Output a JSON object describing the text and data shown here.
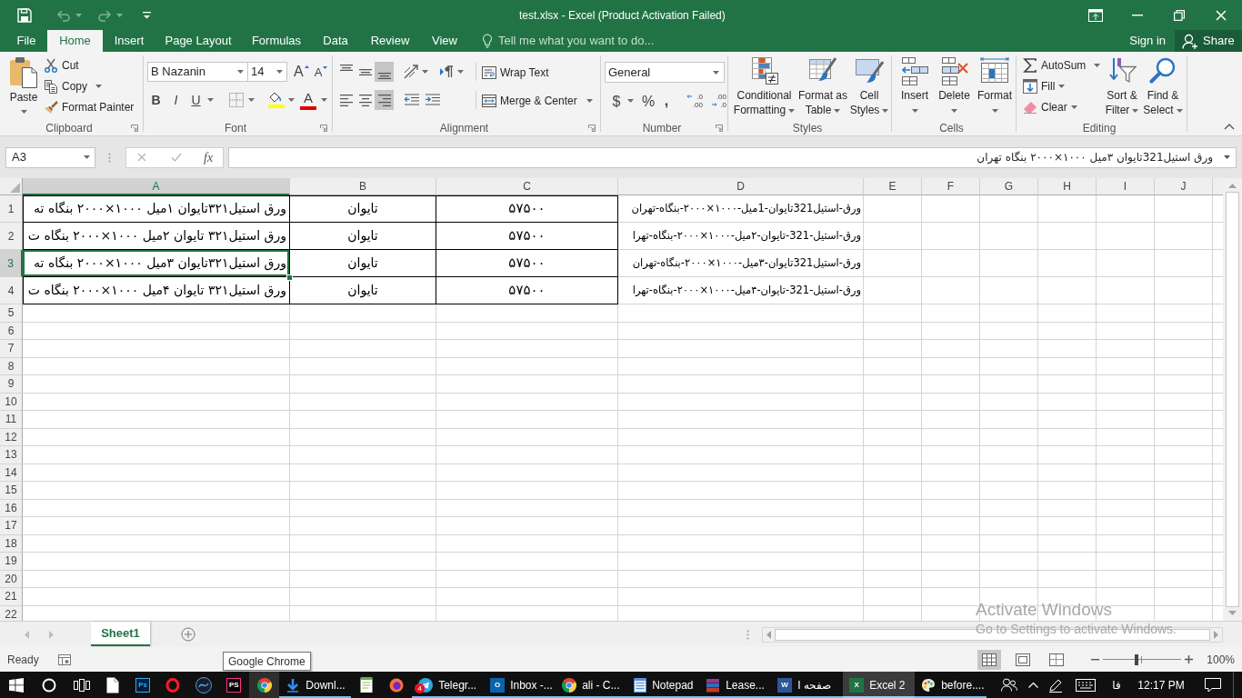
{
  "title_bar": {
    "title": "test.xlsx - Excel (Product Activation Failed)",
    "quick_access": [
      {
        "kind": "save",
        "disabled": false
      },
      {
        "kind": "undo",
        "disabled": true
      },
      {
        "kind": "redo",
        "disabled": true
      },
      {
        "kind": "customize",
        "disabled": false
      }
    ]
  },
  "ribbon_tabs": [
    {
      "label": "File",
      "selected": false
    },
    {
      "label": "Home",
      "selected": true
    },
    {
      "label": "Insert",
      "selected": false
    },
    {
      "label": "Page Layout",
      "selected": false
    },
    {
      "label": "Formulas",
      "selected": false
    },
    {
      "label": "Data",
      "selected": false
    },
    {
      "label": "Review",
      "selected": false
    },
    {
      "label": "View",
      "selected": false
    }
  ],
  "tell_me": {
    "placeholder": "Tell me what you want to do..."
  },
  "account": {
    "sign_in": "Sign in",
    "share": "Share"
  },
  "ribbon": {
    "clipboard": {
      "label": "Clipboard",
      "paste": "Paste",
      "cut": "Cut",
      "copy": "Copy",
      "format_painter": "Format Painter"
    },
    "font": {
      "label": "Font",
      "font_name": "B Nazanin",
      "font_size": "14",
      "grow_font": "A",
      "shrink_font": "A",
      "bold": "B",
      "italic": "I",
      "underline": "U",
      "font_color": "A"
    },
    "alignment": {
      "label": "Alignment",
      "vertical": [
        {
          "kind": "top",
          "selected": false
        },
        {
          "kind": "middle",
          "selected": false
        },
        {
          "kind": "bottom",
          "selected": true
        }
      ],
      "horizontal": [
        {
          "kind": "left",
          "selected": false
        },
        {
          "kind": "center",
          "selected": false
        },
        {
          "kind": "right",
          "selected": true
        }
      ],
      "wrap_text": "Wrap Text",
      "merge_center": "Merge & Center"
    },
    "number": {
      "label": "Number",
      "format": "General",
      "currency": "$",
      "percent": "%",
      "comma": ",",
      "increase_decimal": [
        ".0",
        ".00"
      ],
      "decrease_decimal": [
        ".00",
        ".0"
      ]
    },
    "styles": {
      "label": "Styles",
      "buttons": [
        {
          "kind": "conditional",
          "lines": [
            "Conditional",
            "Formatting"
          ]
        },
        {
          "kind": "table",
          "lines": [
            "Format as",
            "Table"
          ]
        },
        {
          "kind": "cell_styles",
          "lines": [
            "Cell",
            "Styles"
          ]
        }
      ]
    },
    "cells": {
      "label": "Cells",
      "buttons": [
        {
          "kind": "insert",
          "label": "Insert"
        },
        {
          "kind": "delete",
          "label": "Delete"
        },
        {
          "kind": "format",
          "label": "Format"
        }
      ]
    },
    "editing": {
      "label": "Editing",
      "autosum": "AutoSum",
      "fill": "Fill",
      "clear": "Clear",
      "buttons": [
        {
          "kind": "sort",
          "lines": [
            "Sort &",
            "Filter"
          ]
        },
        {
          "kind": "find",
          "lines": [
            "Find &",
            "Select"
          ]
        }
      ]
    }
  },
  "formula_bar": {
    "name_box": "A3",
    "insert_function": "fx",
    "formula": "ورق استیل321تایوان ۳میل ۱۰۰۰×۲۰۰۰ بنگاه تهران"
  },
  "sheet": {
    "columns": [
      {
        "label": "A",
        "selected": true
      },
      {
        "label": "B",
        "selected": false
      },
      {
        "label": "C",
        "selected": false
      },
      {
        "label": "D",
        "selected": false
      },
      {
        "label": "E",
        "selected": false
      },
      {
        "label": "F",
        "selected": false
      },
      {
        "label": "G",
        "selected": false
      },
      {
        "label": "H",
        "selected": false
      },
      {
        "label": "I",
        "selected": false
      },
      {
        "label": "J",
        "selected": false
      }
    ],
    "rows": [
      {
        "label": "1",
        "selected": false,
        "cells": {
          "column_a": {
            "text": "ورق استیل۳۲۱تایوان ۱میل ۱۰۰۰×۲۰۰۰ بنگاه ته",
            "selected": false,
            "bordered": true
          },
          "column_b": {
            "text": "تایوان",
            "selected": false,
            "bordered": true
          },
          "column_c": {
            "text": "۵۷۵۰۰",
            "selected": false,
            "bordered": true
          },
          "column_d": {
            "text": "ورق-استیل321تایوان-1میل-۱۰۰۰×۲۰۰۰-بنگاه-تهران",
            "selected": false,
            "bordered": false
          }
        }
      },
      {
        "label": "2",
        "selected": false,
        "cells": {
          "column_a": {
            "text": "ورق استیل۳۲۱ تایوان ۲میل ۱۰۰۰×۲۰۰۰ بنگاه ت",
            "selected": false,
            "bordered": true
          },
          "column_b": {
            "text": "تایوان",
            "selected": false,
            "bordered": true
          },
          "column_c": {
            "text": "۵۷۵۰۰",
            "selected": false,
            "bordered": true
          },
          "column_d": {
            "text": "ورق-استیل-321-تایوان-۲میل-۱۰۰۰×۲۰۰۰-بنگاه-تهرا",
            "selected": false,
            "bordered": false
          }
        }
      },
      {
        "label": "3",
        "selected": true,
        "cells": {
          "column_a": {
            "text": "ورق استیل۳۲۱تایوان ۳میل ۱۰۰۰×۲۰۰۰ بنگاه ته",
            "selected": true,
            "bordered": true
          },
          "column_b": {
            "text": "تایوان",
            "selected": false,
            "bordered": true
          },
          "column_c": {
            "text": "۵۷۵۰۰",
            "selected": false,
            "bordered": true
          },
          "column_d": {
            "text": "ورق-استیل321تایوان-۳میل-۱۰۰۰×۲۰۰۰-بنگاه-تهران",
            "selected": false,
            "bordered": false
          }
        }
      },
      {
        "label": "4",
        "selected": false,
        "cells": {
          "column_a": {
            "text": "ورق استیل۳۲۱ تایوان ۴میل ۱۰۰۰×۲۰۰۰ بنگاه ت",
            "selected": false,
            "bordered": true
          },
          "column_b": {
            "text": "تایوان",
            "selected": false,
            "bordered": true
          },
          "column_c": {
            "text": "۵۷۵۰۰",
            "selected": false,
            "bordered": true
          },
          "column_d": {
            "text": "ورق-استیل-321-تایوان-۴میل-۱۰۰۰×۲۰۰۰-بنگاه-تهرا",
            "selected": false,
            "bordered": false
          }
        }
      },
      {
        "label": "5",
        "selected": false
      },
      {
        "label": "6",
        "selected": false
      },
      {
        "label": "7",
        "selected": false
      },
      {
        "label": "8",
        "selected": false
      },
      {
        "label": "9",
        "selected": false
      },
      {
        "label": "10",
        "selected": false
      },
      {
        "label": "11",
        "selected": false
      },
      {
        "label": "12",
        "selected": false
      },
      {
        "label": "13",
        "selected": false
      },
      {
        "label": "14",
        "selected": false
      },
      {
        "label": "15",
        "selected": false
      },
      {
        "label": "16",
        "selected": false
      },
      {
        "label": "17",
        "selected": false
      },
      {
        "label": "18",
        "selected": false
      },
      {
        "label": "19",
        "selected": false
      },
      {
        "label": "20",
        "selected": false
      },
      {
        "label": "21",
        "selected": false
      },
      {
        "label": "22",
        "selected": false
      }
    ]
  },
  "sheet_tabs": [
    {
      "label": "Sheet1",
      "selected": true
    }
  ],
  "status_bar": {
    "status": "Ready",
    "views": [
      {
        "kind": "normal",
        "selected": true
      },
      {
        "kind": "page_layout",
        "selected": false
      },
      {
        "kind": "page_break",
        "selected": false
      }
    ],
    "zoom": {
      "level": 0.43,
      "reading": "100%"
    }
  },
  "tooltip": {
    "text": "Google Chrome"
  },
  "activation_notice": {
    "title": "Activate Windows",
    "hint": "Go to Settings to activate Windows."
  },
  "taskbar": {
    "apps": [
      {
        "kind": "document",
        "running": false,
        "hovered": false,
        "selected": false
      },
      {
        "kind": "photoshop",
        "glyph": "Ps",
        "running": false,
        "hovered": false,
        "selected": false
      },
      {
        "kind": "opera",
        "running": false,
        "hovered": false,
        "selected": false
      },
      {
        "kind": "nox",
        "running": false,
        "hovered": false,
        "selected": false
      },
      {
        "kind": "phpstorm",
        "glyph": "PS",
        "running": false,
        "hovered": false,
        "selected": false
      },
      {
        "kind": "chrome",
        "running": false,
        "hovered": true,
        "selected": false
      },
      {
        "kind": "download",
        "label": "Downl...",
        "running": true,
        "hovered": false,
        "selected": false
      },
      {
        "kind": "notepadpp",
        "running": false,
        "hovered": false,
        "selected": false
      },
      {
        "kind": "firefox",
        "running": false,
        "hovered": false,
        "selected": false
      },
      {
        "kind": "telegram",
        "label": "Telegr...",
        "badge": "4",
        "running": true,
        "hovered": false,
        "selected": false
      },
      {
        "kind": "outlook",
        "glyph": "O",
        "label": "Inbox -...",
        "running": true,
        "hovered": false,
        "selected": false
      },
      {
        "kind": "chrome",
        "label": "ali - C...",
        "running": true,
        "hovered": false,
        "selected": false
      },
      {
        "kind": "notepad",
        "label": "Notepad",
        "running": true,
        "hovered": false,
        "selected": false
      },
      {
        "kind": "winrar",
        "label": "Lease...",
        "running": true,
        "hovered": false,
        "selected": false
      },
      {
        "kind": "word",
        "glyph": "W",
        "label": "I صفحه",
        "running": true,
        "hovered": false,
        "selected": false
      },
      {
        "kind": "excel",
        "glyph": "X",
        "label": "Excel 2",
        "running": true,
        "hovered": false,
        "selected": true
      },
      {
        "kind": "paint",
        "label": "before....",
        "running": true,
        "hovered": false,
        "selected": false
      }
    ],
    "language": "فا",
    "time": "12:17 PM"
  }
}
